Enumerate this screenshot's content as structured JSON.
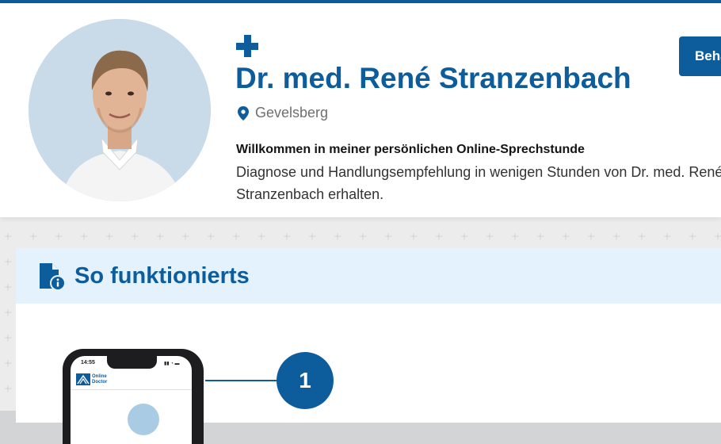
{
  "header": {
    "doctor_name": "Dr. med. René Stranzenbach",
    "location": "Gevelsberg",
    "welcome_title": "Willkommen in meiner persönlichen Online-Sprechstunde",
    "welcome_text": "Diagnose und Handlungsempfehlung in wenigen Stunden von Dr. med. René Stranzenbach erhalten.",
    "cta_label": "Behandlung starten"
  },
  "section": {
    "title": "So funktionierts"
  },
  "steps": [
    {
      "number": "1"
    }
  ],
  "phone": {
    "time": "14:55",
    "brand_line1": "Online",
    "brand_line2": "Doctor"
  },
  "icons": {
    "header": "plus-icon",
    "location": "map-pin-icon",
    "section": "document-info-icon"
  },
  "colors": {
    "accent": "#0d5c9b",
    "section_bg": "#e3f2fd",
    "page_bg": "#ececec"
  }
}
